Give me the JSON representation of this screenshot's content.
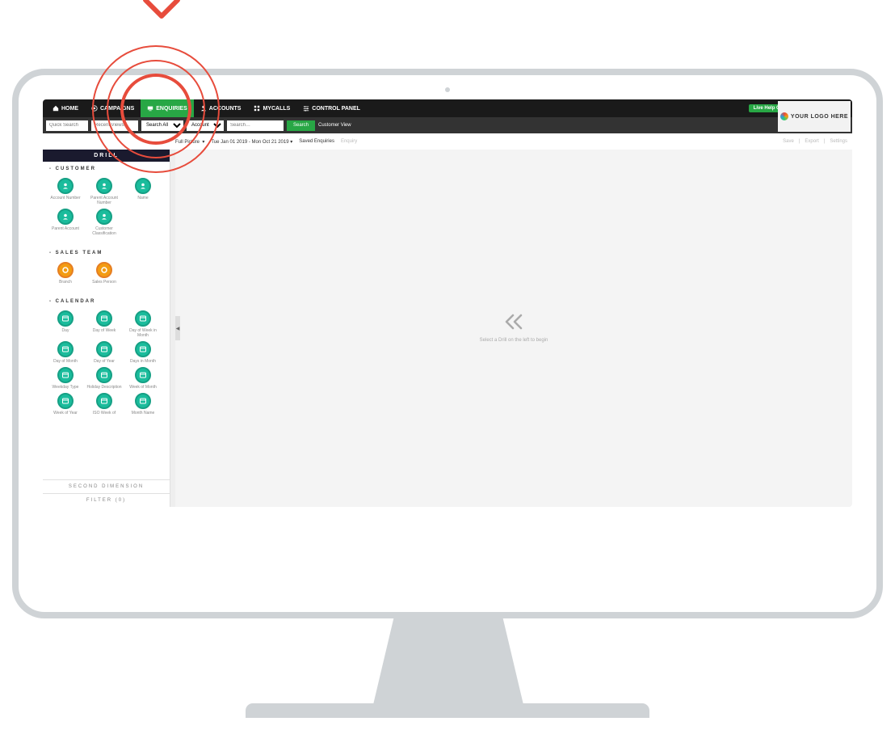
{
  "topnav": {
    "items": [
      {
        "label": "HOME",
        "icon": "home"
      },
      {
        "label": "CAMPAIGNS",
        "icon": "target"
      },
      {
        "label": "ENQUIRIES",
        "icon": "screen",
        "active": true
      },
      {
        "label": "ACCOUNTS",
        "icon": "person"
      },
      {
        "label": "MYCALLS",
        "icon": "grid"
      },
      {
        "label": "CONTROL PANEL",
        "icon": "sliders"
      }
    ],
    "live_help": "Live Help Online",
    "help_icon": "?",
    "user_icon": "●",
    "menu_icon": "—"
  },
  "searchbar": {
    "quick_search": "Quick Search",
    "recent_views": "Recent Views",
    "search_all": "Search All",
    "account": "Account",
    "search_placeholder": "Search…",
    "search_btn": "Search",
    "customer_view": "Customer View"
  },
  "logo": {
    "text": "YOUR LOGO HERE"
  },
  "subtoolbar": {
    "full_picture": "Full Picture",
    "date_range": "Tue Jan 01 2019 - Mon Oct 21 2019",
    "saved_enquiries": "Saved Enquiries",
    "enquiry": "Enquiry",
    "right": [
      "Save",
      "Export",
      "Settings"
    ]
  },
  "sidebar": {
    "header": "DRILL",
    "sections": [
      {
        "title": "CUSTOMER",
        "color": "teal",
        "items": [
          "Account Number",
          "Parent Account Number",
          "Name",
          "Parent Account",
          "Customer Classification"
        ]
      },
      {
        "title": "SALES TEAM",
        "color": "orange",
        "items": [
          "Branch",
          "Sales Person"
        ]
      },
      {
        "title": "CALENDAR",
        "color": "teal",
        "items": [
          "Day",
          "Day of Week",
          "Day of Week in Month",
          "Day of Month",
          "Day of Year",
          "Days in Month",
          "Weekday Type",
          "Holiday Description",
          "Week of Month",
          "Week of Year",
          "ISO Week of",
          "Month Name"
        ]
      }
    ],
    "second_dimension": "SECOND DIMENSION",
    "filter": "FILTER (0)"
  },
  "main": {
    "placeholder_text": "Select a Drill on the left to begin",
    "collapse": "◀"
  }
}
